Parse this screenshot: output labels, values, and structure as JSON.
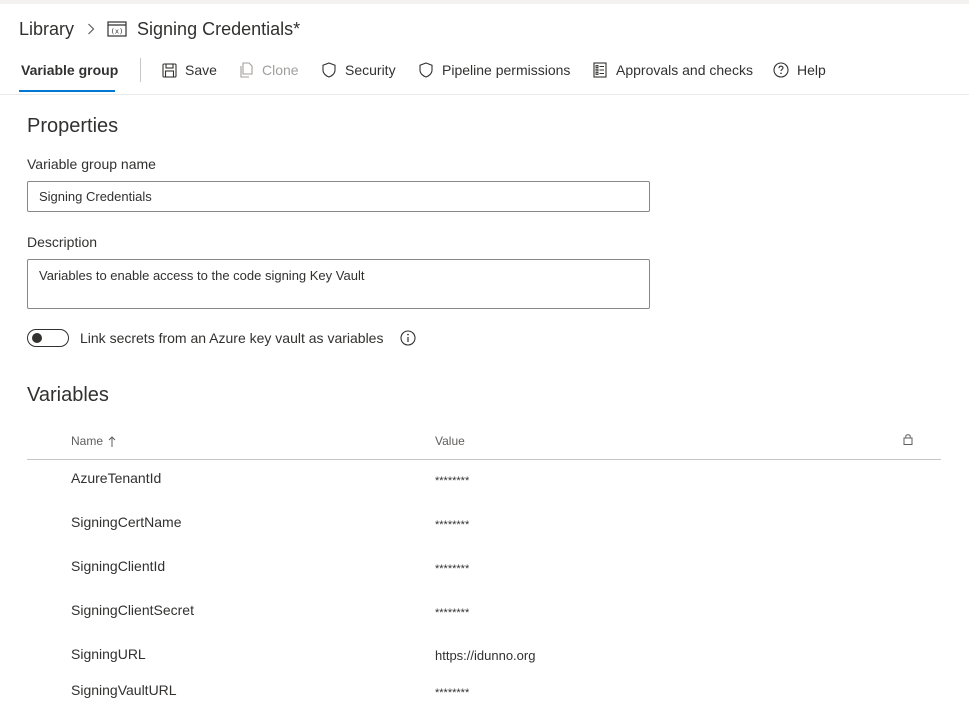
{
  "breadcrumb": {
    "root": "Library",
    "current": "Signing Credentials*"
  },
  "toolbar": {
    "active_tab": "Variable group",
    "save": "Save",
    "clone": "Clone",
    "security": "Security",
    "pipeline_permissions": "Pipeline permissions",
    "approvals": "Approvals and checks",
    "help": "Help"
  },
  "properties": {
    "title": "Properties",
    "name_label": "Variable group name",
    "name_value": "Signing Credentials",
    "description_label": "Description",
    "description_value": "Variables to enable access to the code signing Key Vault",
    "link_secrets_label": "Link secrets from an Azure key vault as variables",
    "link_secrets_enabled": false
  },
  "variables": {
    "title": "Variables",
    "columns": {
      "name": "Name",
      "value": "Value"
    },
    "rows": [
      {
        "name": "AzureTenantId",
        "value": "********",
        "secret": true
      },
      {
        "name": "SigningCertName",
        "value": "********",
        "secret": true
      },
      {
        "name": "SigningClientId",
        "value": "********",
        "secret": true
      },
      {
        "name": "SigningClientSecret",
        "value": "********",
        "secret": true
      },
      {
        "name": "SigningURL",
        "value": "https://idunno.org",
        "secret": false
      },
      {
        "name": "SigningVaultURL",
        "value": "********",
        "secret": true
      }
    ]
  },
  "colors": {
    "accent": "#0078d4",
    "text": "#323130",
    "disabled": "#a19f9d"
  }
}
